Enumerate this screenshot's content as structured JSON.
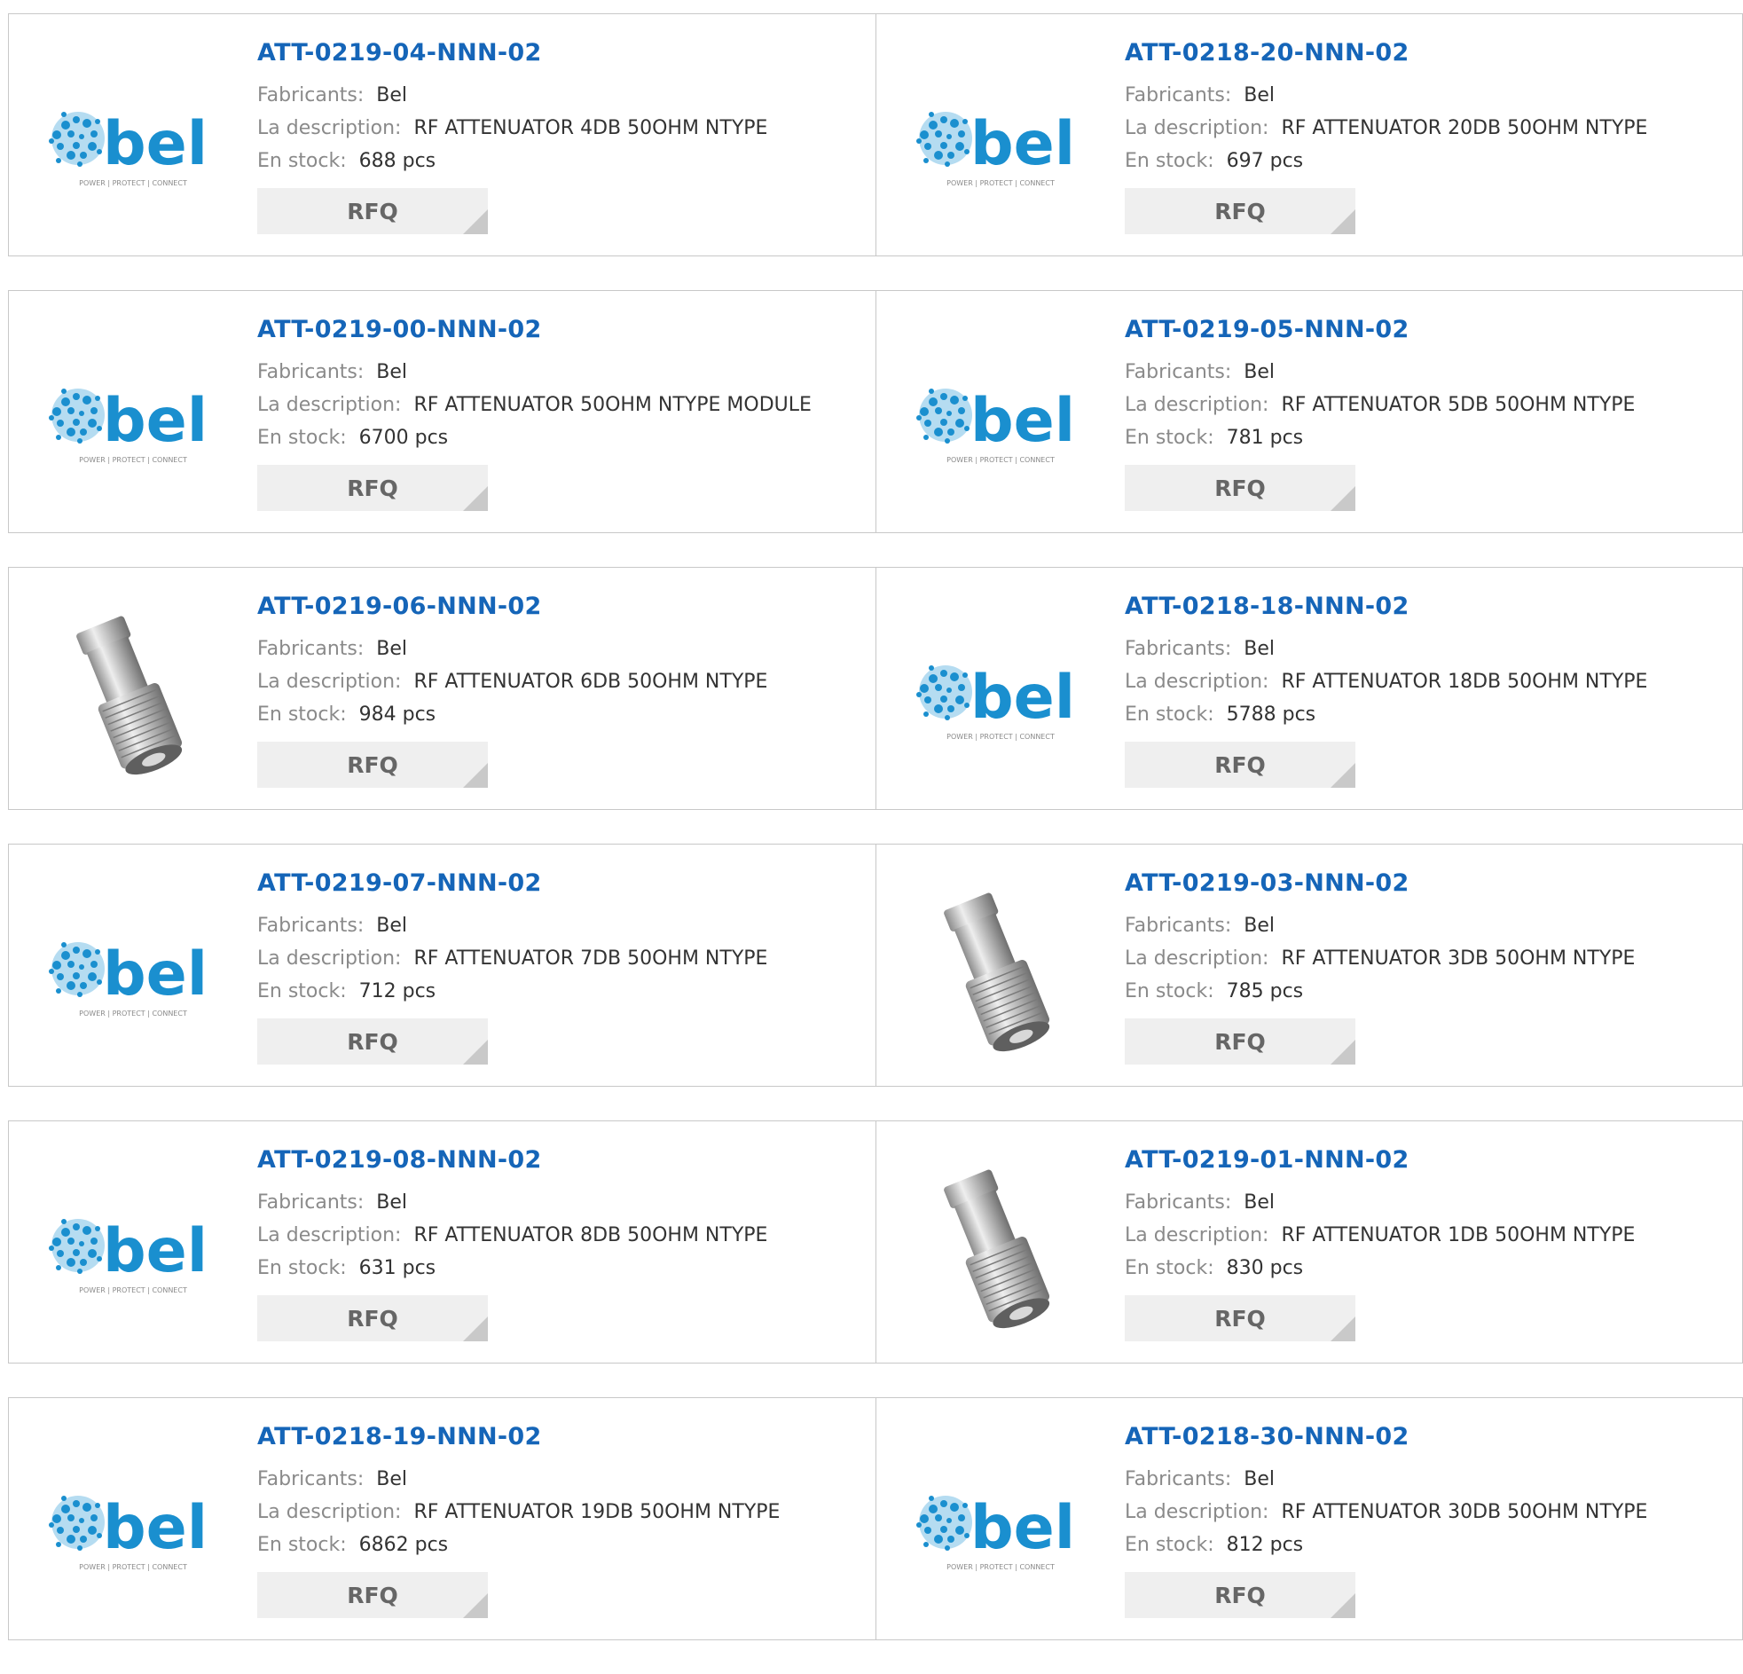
{
  "labels": {
    "manufacturer": "Fabricants:",
    "description": "La description:",
    "stock": "En stock:",
    "rfq": "RFQ"
  },
  "logo": {
    "brand": "bel",
    "tagline": "POWER | PROTECT | CONNECT"
  },
  "products": [
    {
      "part": "ATT-0219-04-NNN-02",
      "manufacturer": "Bel",
      "description": "RF ATTENUATOR 4DB 50OHM NTYPE",
      "stock": "688 pcs",
      "image": "bel-logo"
    },
    {
      "part": "ATT-0218-20-NNN-02",
      "manufacturer": "Bel",
      "description": "RF ATTENUATOR 20DB 50OHM NTYPE",
      "stock": "697 pcs",
      "image": "bel-logo"
    },
    {
      "part": "ATT-0219-00-NNN-02",
      "manufacturer": "Bel",
      "description": "RF ATTENUATOR 50OHM NTYPE MODULE",
      "stock": "6700 pcs",
      "image": "bel-logo"
    },
    {
      "part": "ATT-0219-05-NNN-02",
      "manufacturer": "Bel",
      "description": "RF ATTENUATOR 5DB 50OHM NTYPE",
      "stock": "781 pcs",
      "image": "bel-logo"
    },
    {
      "part": "ATT-0219-06-NNN-02",
      "manufacturer": "Bel",
      "description": "RF ATTENUATOR 6DB 50OHM NTYPE",
      "stock": "984 pcs",
      "image": "connector-photo"
    },
    {
      "part": "ATT-0218-18-NNN-02",
      "manufacturer": "Bel",
      "description": "RF ATTENUATOR 18DB 50OHM NTYPE",
      "stock": "5788 pcs",
      "image": "bel-logo"
    },
    {
      "part": "ATT-0219-07-NNN-02",
      "manufacturer": "Bel",
      "description": "RF ATTENUATOR 7DB 50OHM NTYPE",
      "stock": "712 pcs",
      "image": "bel-logo"
    },
    {
      "part": "ATT-0219-03-NNN-02",
      "manufacturer": "Bel",
      "description": "RF ATTENUATOR 3DB 50OHM NTYPE",
      "stock": "785 pcs",
      "image": "connector-photo"
    },
    {
      "part": "ATT-0219-08-NNN-02",
      "manufacturer": "Bel",
      "description": "RF ATTENUATOR 8DB 50OHM NTYPE",
      "stock": "631 pcs",
      "image": "bel-logo"
    },
    {
      "part": "ATT-0219-01-NNN-02",
      "manufacturer": "Bel",
      "description": "RF ATTENUATOR 1DB 50OHM NTYPE",
      "stock": "830 pcs",
      "image": "connector-photo"
    },
    {
      "part": "ATT-0218-19-NNN-02",
      "manufacturer": "Bel",
      "description": "RF ATTENUATOR 19DB 50OHM NTYPE",
      "stock": "6862 pcs",
      "image": "bel-logo"
    },
    {
      "part": "ATT-0218-30-NNN-02",
      "manufacturer": "Bel",
      "description": "RF ATTENUATOR 30DB 50OHM NTYPE",
      "stock": "812 pcs",
      "image": "bel-logo"
    }
  ],
  "colors": {
    "part_link": "#1565b8",
    "logo_blue": "#1a8fcf",
    "rfq_bg": "#efefef",
    "border": "#c8c8c8"
  }
}
